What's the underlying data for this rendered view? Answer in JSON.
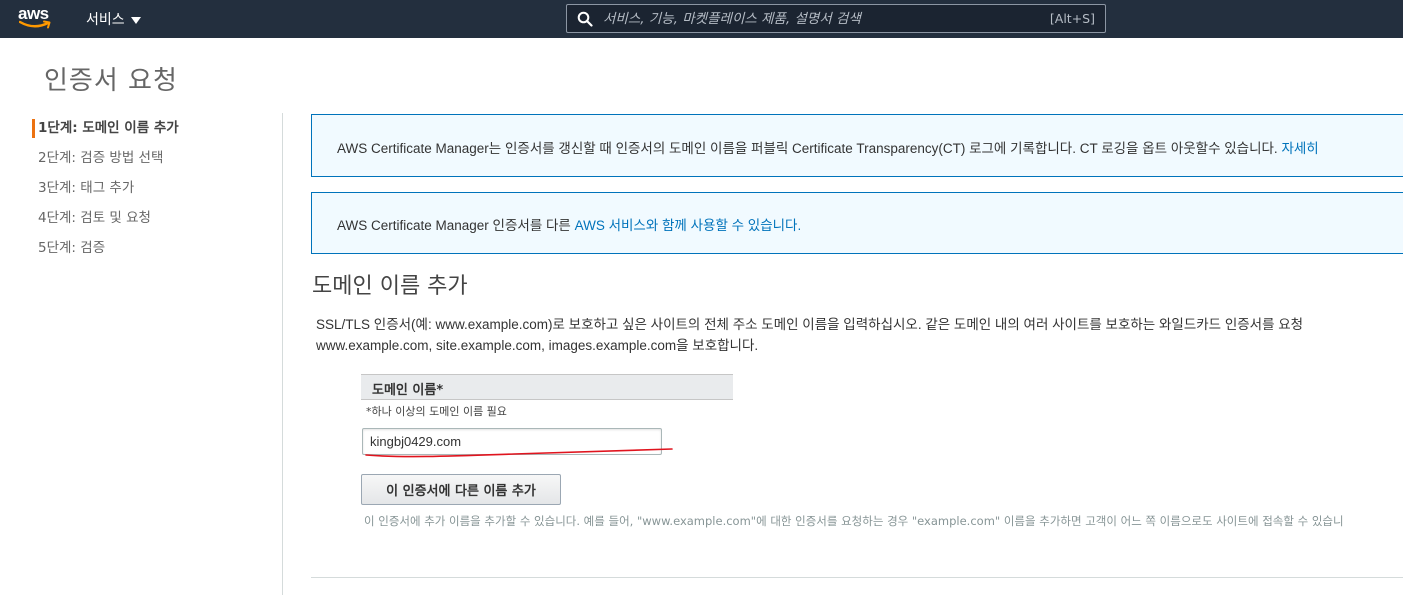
{
  "nav": {
    "logo_text": "aws",
    "services_label": "서비스",
    "search_placeholder": "서비스, 기능, 마켓플레이스 제품, 설명서 검색",
    "search_shortcut": "[Alt+S]"
  },
  "page": {
    "title": "인증서 요청"
  },
  "steps": [
    {
      "label": "1단계: 도메인 이름 추가",
      "active": true
    },
    {
      "label": "2단계: 검증 방법 선택",
      "active": false
    },
    {
      "label": "3단계: 태그 추가",
      "active": false
    },
    {
      "label": "4단계: 검토 및 요청",
      "active": false
    },
    {
      "label": "5단계: 검증",
      "active": false
    }
  ],
  "info_ct": {
    "text": "AWS Certificate Manager는 인증서를 갱신할 때 인증서의 도메인 이름을 퍼블릭 Certificate Transparency(CT) 로그에 기록합니다. CT 로깅을 옵트 아웃할수 있습니다. ",
    "link": "자세히"
  },
  "info_services": {
    "text": "AWS Certificate Manager 인증서를 다른 ",
    "link": "AWS 서비스와 함께 사용할 수 있습니다."
  },
  "section": {
    "title": "도메인 이름 추가",
    "description_line1": "SSL/TLS 인증서(예: www.example.com)로 보호하고 싶은 사이트의 전체 주소 도메인 이름을 입력하십시오. 같은 도메인 내의 여러 사이트를 보호하는 와일드카드 인증서를 요청",
    "description_line2": "www.example.com, site.example.com, images.example.com을 보호합니다."
  },
  "domain_field": {
    "header": "도메인 이름*",
    "required_note": "*하나 이상의 도메인 이름 필요",
    "value": "kingbj0429.com"
  },
  "add_button": {
    "label": "이 인증서에 다른 이름 추가"
  },
  "hint": "이 인증서에 추가 이름을 추가할 수 있습니다. 예를 들어, \"www.example.com\"에 대한 인증서를 요청하는 경우 \"example.com\" 이름을 추가하면 고객이 어느 쪽 이름으로도 사이트에 접속할 수 있습니",
  "colors": {
    "nav_bg": "#232f3e",
    "accent": "#ec7211",
    "link": "#0073bb",
    "info_bg": "#f1faff",
    "annotation": "#e0141e"
  }
}
